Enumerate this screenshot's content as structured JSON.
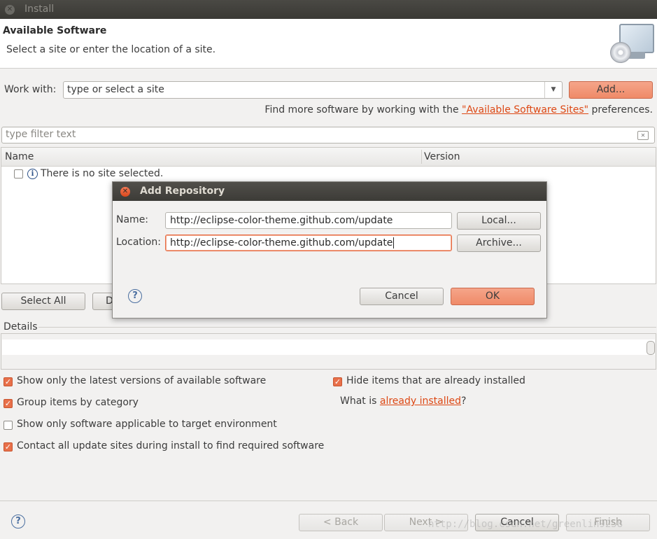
{
  "window": {
    "title": "Install"
  },
  "header": {
    "title": "Available Software",
    "subtitle": "Select a site or enter the location of a site."
  },
  "work_with": {
    "label": "Work with:",
    "value": "type or select a site",
    "add_button": "Add...",
    "hint_prefix": "Find more software by working with the ",
    "hint_link": "\"Available Software Sites\"",
    "hint_suffix": " preferences."
  },
  "filter": {
    "placeholder": "type filter text"
  },
  "table": {
    "columns": [
      "Name",
      "Version"
    ],
    "rows": [
      {
        "name": "There is no site selected."
      }
    ]
  },
  "selection_buttons": {
    "select_all": "Select All",
    "deselect_all_partial": "D"
  },
  "details": {
    "label": "Details"
  },
  "options": {
    "left": [
      {
        "label": "Show only the latest versions of available software",
        "checked": true
      },
      {
        "label": "Group items by category",
        "checked": true
      },
      {
        "label": "Show only software applicable to target environment",
        "checked": false
      },
      {
        "label": "Contact all update sites during install to find required software",
        "checked": true
      }
    ],
    "right": [
      {
        "label": "Hide items that are already installed",
        "checked": true
      }
    ],
    "what_is_prefix": "What is ",
    "what_is_link": "already installed",
    "what_is_suffix": "?"
  },
  "footer": {
    "back": "< Back",
    "next": "Next >",
    "cancel": "Cancel",
    "finish": "Finish",
    "watermark": "http://blog.csdn.net/greenlin9258"
  },
  "dialog": {
    "title": "Add Repository",
    "name_label": "Name:",
    "name_value": "http://eclipse-color-theme.github.com/update",
    "location_label": "Location:",
    "location_value": "http://eclipse-color-theme.github.com/update",
    "local_button": "Local...",
    "archive_button": "Archive...",
    "cancel_button": "Cancel",
    "ok_button": "OK"
  },
  "colors": {
    "accent": "#e8704a",
    "link": "#dd4814",
    "titlebar": "#3c3b37"
  }
}
